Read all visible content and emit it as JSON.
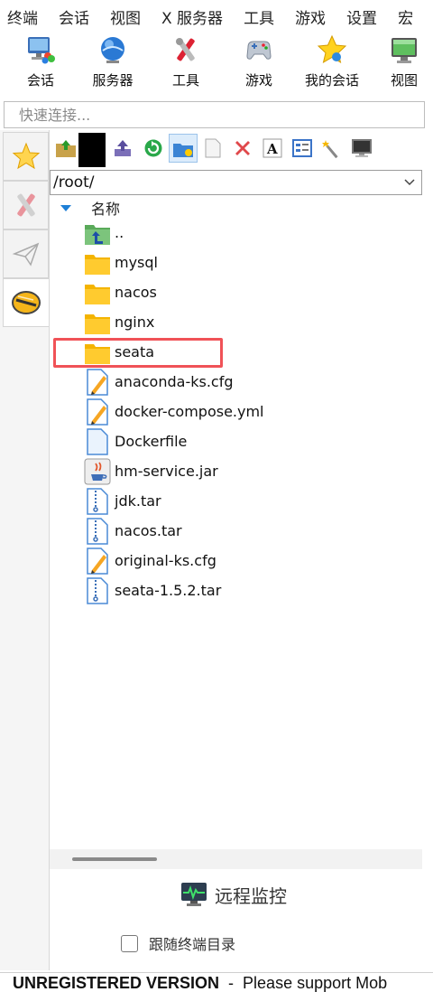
{
  "menu": [
    "终端",
    "会话",
    "视图",
    "X 服务器",
    "工具",
    "游戏",
    "设置",
    "宏"
  ],
  "toolbar": {
    "session": "会话",
    "servers": "服务器",
    "tools": "工具",
    "games": "游戏",
    "my_sessions": "我的会话",
    "view": "视图"
  },
  "quick_connect": {
    "placeholder": "快速连接..."
  },
  "sftp": {
    "path": "/root/",
    "column_name": "名称",
    "files": [
      {
        "name": "..",
        "icon": "parent-folder-icon"
      },
      {
        "name": "mysql",
        "icon": "folder-icon"
      },
      {
        "name": "nacos",
        "icon": "folder-icon"
      },
      {
        "name": "nginx",
        "icon": "folder-icon"
      },
      {
        "name": "seata",
        "icon": "folder-icon"
      },
      {
        "name": "anaconda-ks.cfg",
        "icon": "text-file-icon"
      },
      {
        "name": "docker-compose.yml",
        "icon": "text-file-icon"
      },
      {
        "name": "Dockerfile",
        "icon": "blank-file-icon"
      },
      {
        "name": "hm-service.jar",
        "icon": "java-file-icon"
      },
      {
        "name": "jdk.tar",
        "icon": "archive-file-icon"
      },
      {
        "name": "nacos.tar",
        "icon": "archive-file-icon"
      },
      {
        "name": "original-ks.cfg",
        "icon": "text-file-icon"
      },
      {
        "name": "seata-1.5.2.tar",
        "icon": "archive-file-icon"
      }
    ],
    "remote_monitor": "远程监控",
    "follow_terminal": "跟随终端目录"
  },
  "status": {
    "bold": "UNREGISTERED VERSION",
    "rest": "  -  Please support Mob"
  },
  "colors": {
    "accent": "#1e7fd6",
    "highlight": "#f05257",
    "folder": "#ffc928"
  }
}
